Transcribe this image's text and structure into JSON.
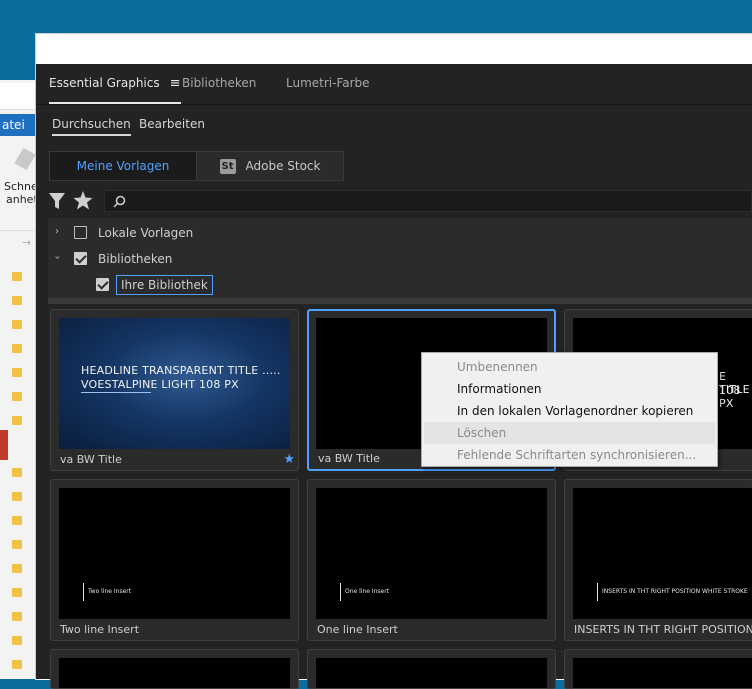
{
  "background_window": {
    "menu_fragment": "atei",
    "button_text_1": "Schne",
    "button_text_2": "anhet"
  },
  "tabs": [
    {
      "label": "Essential Graphics",
      "active": true
    },
    {
      "label": "Bibliotheken",
      "active": false
    },
    {
      "label": "Lumetri-Farbe",
      "active": false
    }
  ],
  "subtabs": [
    {
      "label": "Durchsuchen",
      "active": true
    },
    {
      "label": "Bearbeiten",
      "active": false
    }
  ],
  "segments": {
    "my_templates": "Meine Vorlagen",
    "adobe_stock_badge": "St",
    "adobe_stock": "Adobe Stock"
  },
  "filters": {
    "local_templates": {
      "label": "Lokale Vorlagen",
      "checked": false
    },
    "libraries": {
      "label": "Bibliotheken",
      "checked": true
    },
    "your_library": {
      "label": "Ihre Bibliothek",
      "checked": true
    }
  },
  "cards": [
    {
      "label": "va BW Title",
      "thumb_line1": "HEADLINE TRANSPARENT TITLE .....",
      "thumb_line2": "VOESTALPINE LIGHT 108 PX",
      "starred": true
    },
    {
      "label": "va BW Title",
      "selected": true
    },
    {
      "label": "",
      "thumb_line1": "E TITLE",
      "thumb_line2": "108 PX"
    },
    {
      "label": "Two line Insert",
      "thumb_text": "Two line Insert"
    },
    {
      "label": "One line Insert",
      "thumb_text": "One line Insert"
    },
    {
      "label": "INSERTS IN THT RIGHT POSITION W",
      "thumb_text": "INSERTS IN THT RIGHT POSITION WHITE STROKE"
    }
  ],
  "context_menu": {
    "items": [
      {
        "label": "Umbenennen",
        "disabled": true
      },
      {
        "label": "Informationen",
        "disabled": false
      },
      {
        "label": "In den lokalen Vorlagenordner kopieren",
        "disabled": false
      },
      {
        "label": "Löschen",
        "disabled": true,
        "hovered": true
      },
      {
        "label": "Fehlende Schriftarten synchronisieren...",
        "disabled": true
      }
    ]
  },
  "colors": {
    "accent": "#4ea1ff",
    "panel_bg": "#232323",
    "desktop_bg": "#0a6d9c"
  }
}
